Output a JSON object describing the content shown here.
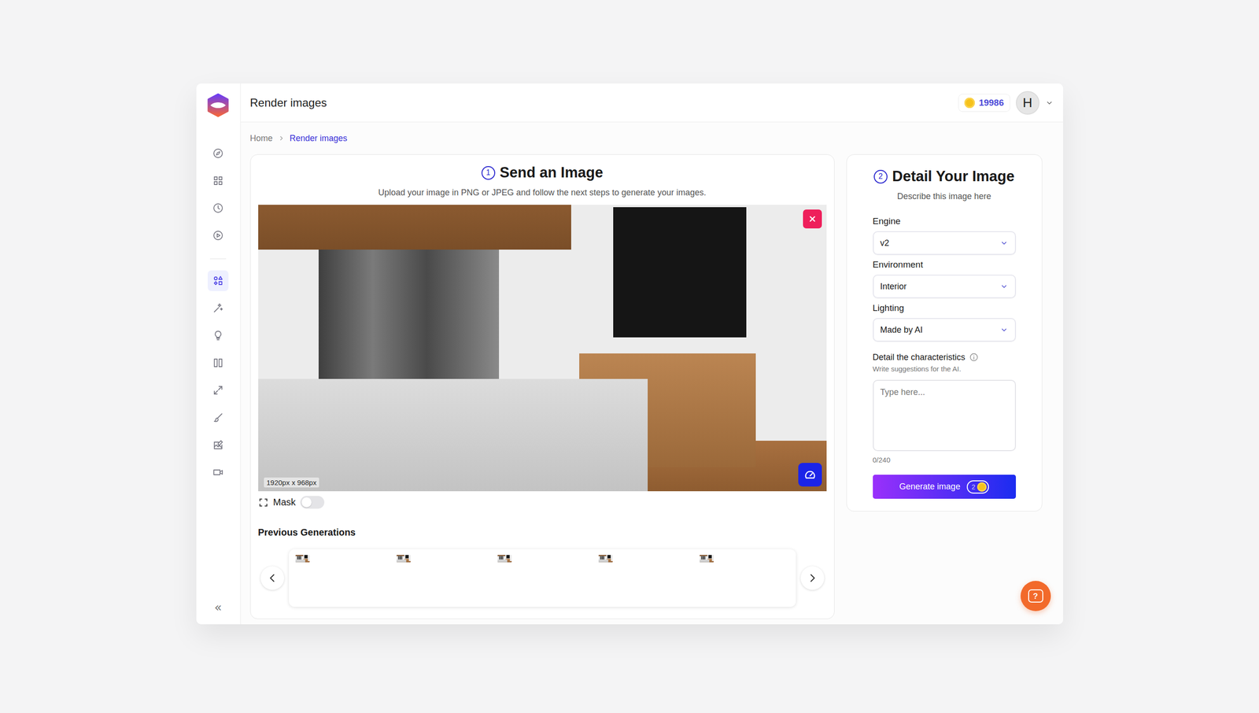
{
  "header": {
    "title": "Render images",
    "coins": "19986",
    "avatar": "H"
  },
  "sidebar": {
    "top_items": [
      {
        "selected": false
      },
      {
        "selected": false
      },
      {
        "selected": false
      },
      {
        "selected": false
      }
    ],
    "tool_items": [
      {
        "selected": true
      },
      {
        "selected": false
      },
      {
        "selected": false
      },
      {
        "selected": false
      },
      {
        "selected": false
      },
      {
        "selected": false
      },
      {
        "selected": false
      },
      {
        "selected": false
      }
    ],
    "collapse": "«"
  },
  "breadcrumb": [
    {
      "label": "Home",
      "selected": false
    },
    {
      "label": "Render images",
      "selected": true
    }
  ],
  "upload": {
    "step": "1",
    "title": "Send an Image",
    "subtitle": "Upload your image in PNG or JPEG and follow the next steps to generate your images.",
    "image_size": "1920px x 968px",
    "mask": {
      "label": "Mask",
      "on": false
    }
  },
  "previous_generations": {
    "title": "Previous Generations",
    "thumbnails": [
      {
        "kind": "photo"
      },
      {
        "kind": "photo"
      },
      {
        "kind": "photo"
      },
      {
        "kind": "photo"
      },
      {
        "kind": "photo"
      }
    ]
  },
  "details": {
    "step": "2",
    "title": "Detail Your Image",
    "subtitle": "Describe this image here",
    "fields": [
      {
        "label": "Engine",
        "value": "v2"
      },
      {
        "label": "Environment",
        "value": "Interior"
      },
      {
        "label": "Lighting",
        "value": "Made by AI"
      }
    ],
    "characteristics": {
      "label": "Detail the characteristics",
      "hint": "Write suggestions for the AI.",
      "placeholder": "Type here...",
      "count": "0/240"
    },
    "generate": {
      "label": "Generate image",
      "cost": "2",
      "on": true
    }
  },
  "help": {
    "label": "?"
  }
}
